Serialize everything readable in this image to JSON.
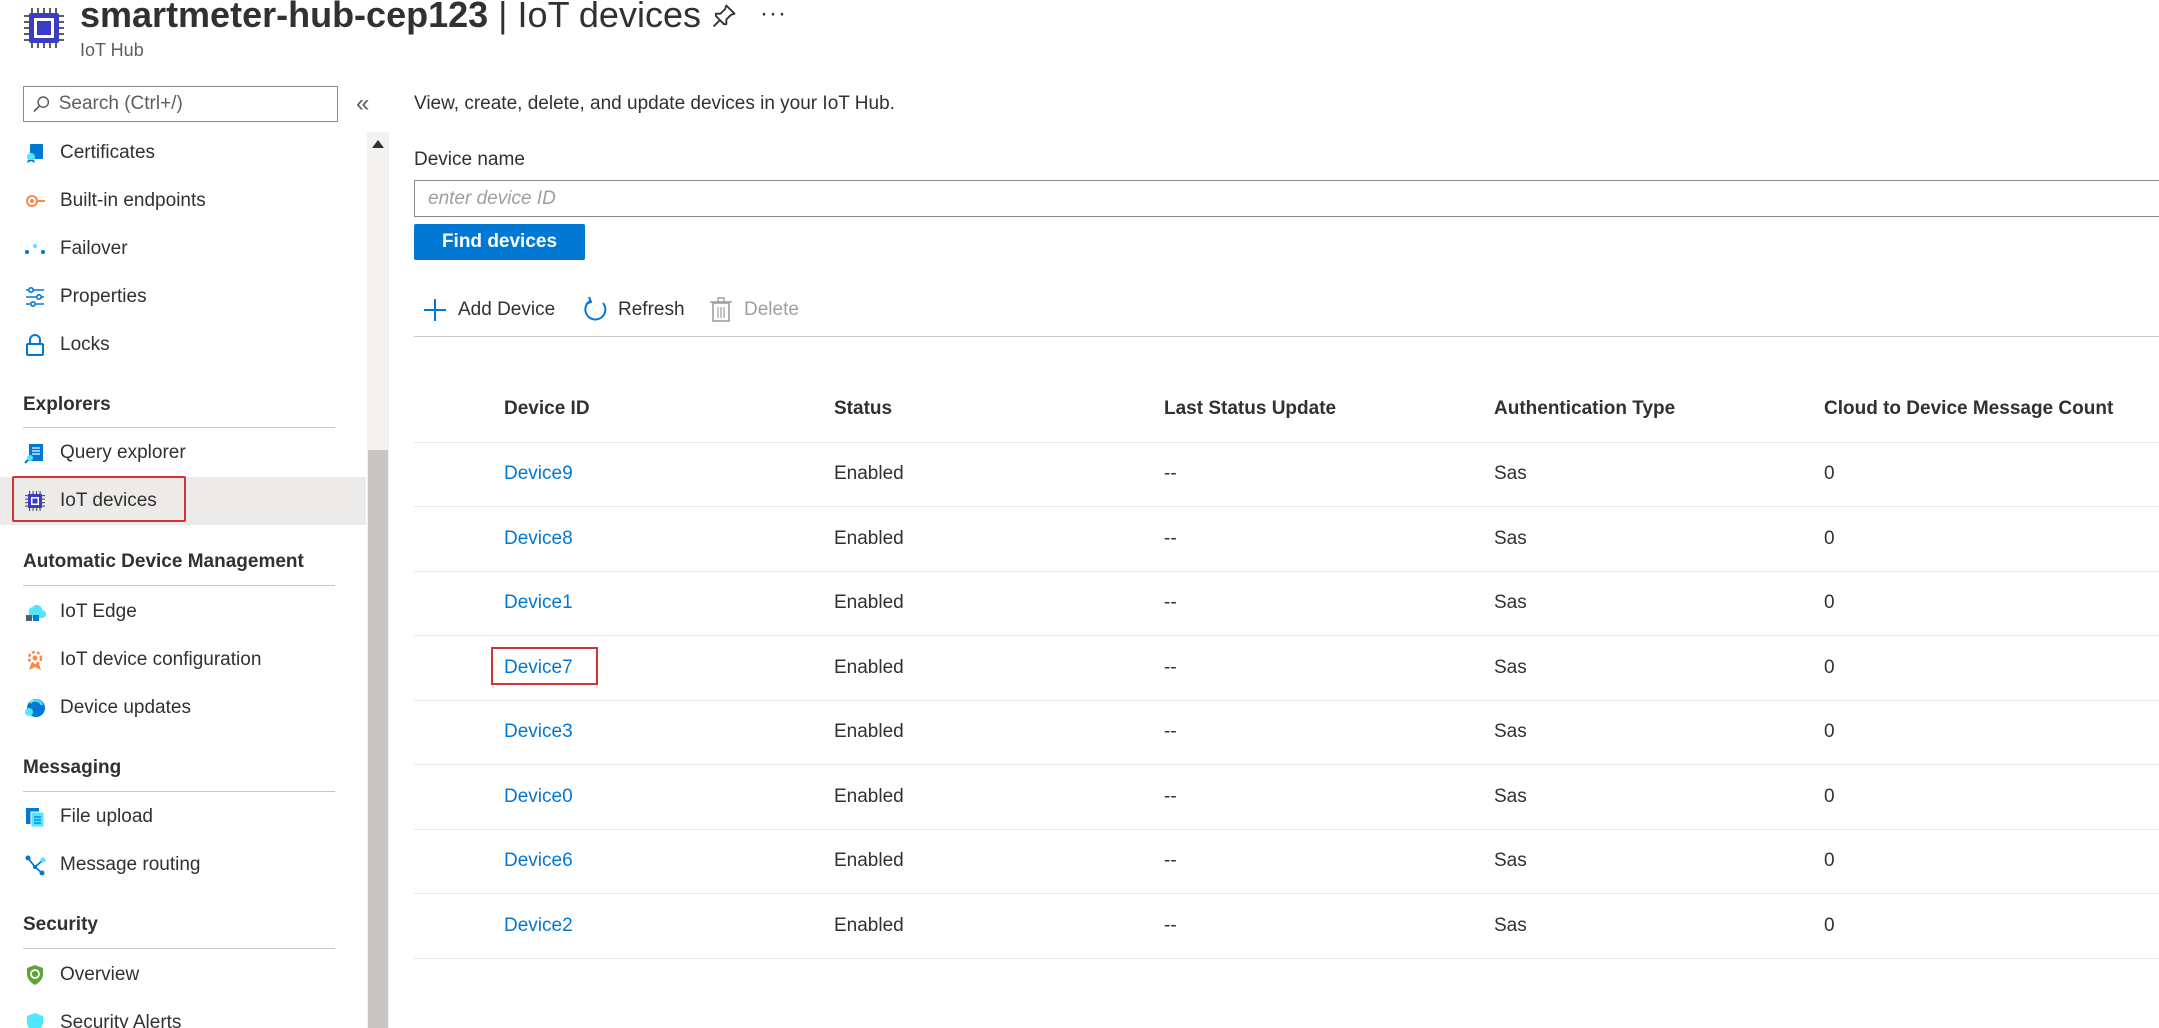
{
  "header": {
    "resource_name": "smartmeter-hub-cep123",
    "separator": "|",
    "page_name": "IoT devices",
    "subtitle": "IoT Hub",
    "more_label": "···"
  },
  "sidebar": {
    "search_placeholder": "Search (Ctrl+/)",
    "collapse_label": "«",
    "items_top": [
      {
        "label": "Certificates",
        "icon": "certificate-icon"
      },
      {
        "label": "Built-in endpoints",
        "icon": "endpoint-icon"
      },
      {
        "label": "Failover",
        "icon": "failover-icon"
      },
      {
        "label": "Properties",
        "icon": "properties-icon"
      },
      {
        "label": "Locks",
        "icon": "lock-icon"
      }
    ],
    "sections": {
      "explorers": "Explorers",
      "adm": "Automatic Device Management",
      "messaging": "Messaging",
      "security": "Security"
    },
    "explorers_items": [
      {
        "label": "Query explorer",
        "icon": "query-explorer-icon"
      },
      {
        "label": "IoT devices",
        "icon": "iot-device-chip-icon"
      }
    ],
    "adm_items": [
      {
        "label": "IoT Edge",
        "icon": "iot-edge-icon"
      },
      {
        "label": "IoT device configuration",
        "icon": "device-configuration-icon"
      },
      {
        "label": "Device updates",
        "icon": "device-updates-icon"
      }
    ],
    "messaging_items": [
      {
        "label": "File upload",
        "icon": "file-upload-icon"
      },
      {
        "label": "Message routing",
        "icon": "message-routing-icon"
      }
    ],
    "security_items": [
      {
        "label": "Overview",
        "icon": "shield-icon"
      },
      {
        "label": "Security Alerts",
        "icon": "security-alerts-icon"
      }
    ]
  },
  "main": {
    "description": "View, create, delete, and update devices in your IoT Hub.",
    "device_name_label": "Device name",
    "device_name_placeholder": "enter device ID",
    "find_button": "Find devices",
    "toolbar": {
      "add": "Add Device",
      "refresh": "Refresh",
      "delete": "Delete"
    },
    "table": {
      "headers": {
        "device_id": "Device ID",
        "status": "Status",
        "last_status_update": "Last Status Update",
        "auth_type": "Authentication Type",
        "c2d_count": "Cloud to Device Message Count"
      },
      "rows": [
        {
          "device_id": "Device9",
          "status": "Enabled",
          "last_status_update": "--",
          "auth_type": "Sas",
          "c2d_count": "0"
        },
        {
          "device_id": "Device8",
          "status": "Enabled",
          "last_status_update": "--",
          "auth_type": "Sas",
          "c2d_count": "0"
        },
        {
          "device_id": "Device1",
          "status": "Enabled",
          "last_status_update": "--",
          "auth_type": "Sas",
          "c2d_count": "0"
        },
        {
          "device_id": "Device7",
          "status": "Enabled",
          "last_status_update": "--",
          "auth_type": "Sas",
          "c2d_count": "0"
        },
        {
          "device_id": "Device3",
          "status": "Enabled",
          "last_status_update": "--",
          "auth_type": "Sas",
          "c2d_count": "0"
        },
        {
          "device_id": "Device0",
          "status": "Enabled",
          "last_status_update": "--",
          "auth_type": "Sas",
          "c2d_count": "0"
        },
        {
          "device_id": "Device6",
          "status": "Enabled",
          "last_status_update": "--",
          "auth_type": "Sas",
          "c2d_count": "0"
        },
        {
          "device_id": "Device2",
          "status": "Enabled",
          "last_status_update": "--",
          "auth_type": "Sas",
          "c2d_count": "0"
        }
      ]
    }
  },
  "colors": {
    "accent": "#0078d4",
    "highlight_border": "#d13438",
    "selected_bg": "#edebe9"
  }
}
